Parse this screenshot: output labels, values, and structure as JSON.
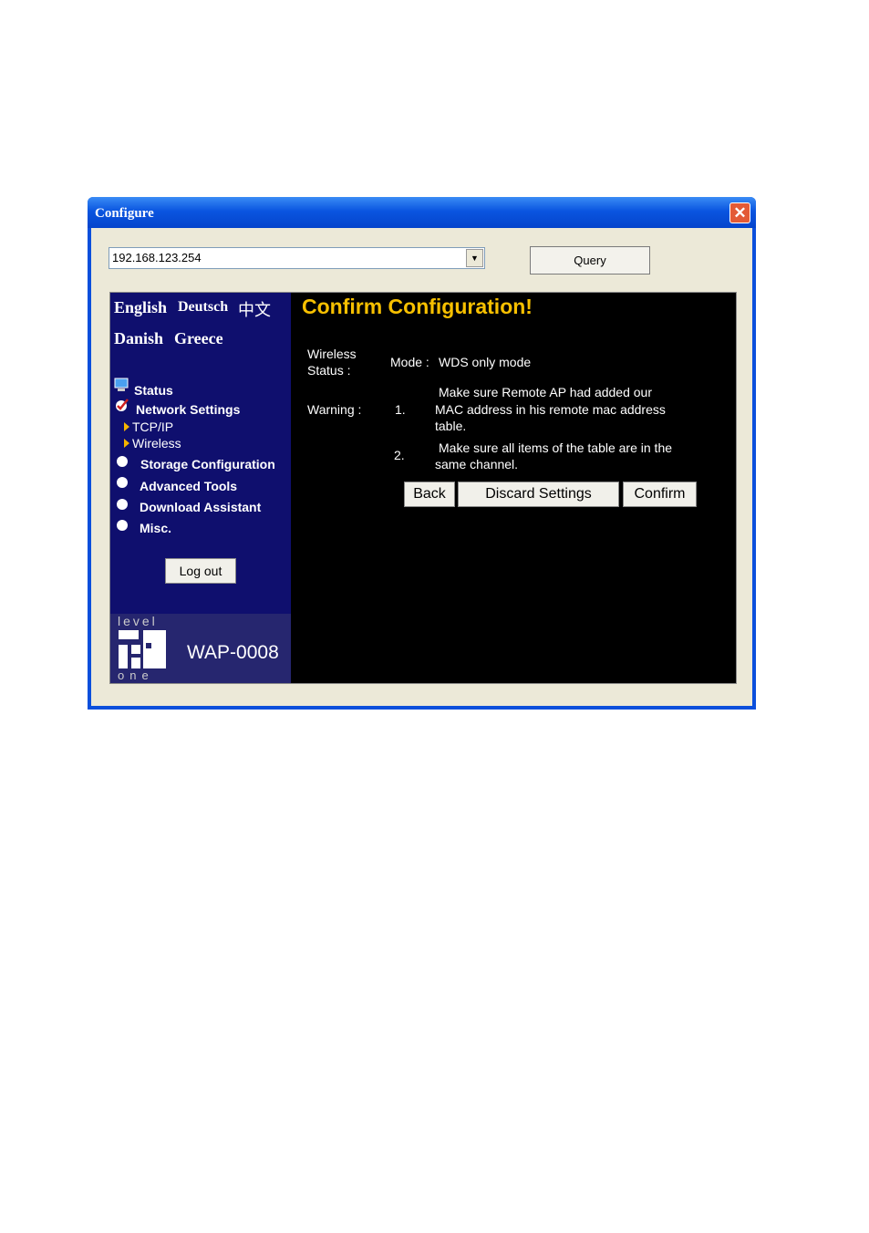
{
  "window": {
    "title": "Configure"
  },
  "address_combo": {
    "value": "192.168.123.254"
  },
  "query_button": "Query",
  "languages": [
    "English",
    "Deutsch",
    "中文",
    "Danish",
    "Greece"
  ],
  "nav": {
    "status": "Status",
    "network_settings": "Network Settings",
    "tcpip": "TCP/IP",
    "wireless": "Wireless",
    "storage": "Storage Configuration",
    "advanced": "Advanced Tools",
    "download": "Download Assistant",
    "misc": "Misc."
  },
  "logout": "Log out",
  "logo": {
    "brand_top": "level",
    "brand_bottom": "one",
    "model": "WAP-0008"
  },
  "main": {
    "heading": "Confirm Configuration!",
    "wireless_status_label1": "Wireless",
    "wireless_status_label2": "Status :",
    "mode_label": "Mode :",
    "mode_value": "WDS only mode",
    "warning_label": "Warning :",
    "item1_num": "1.",
    "item1_line1": "Make sure Remote AP had added our",
    "item1_line2": "MAC address in his remote mac address",
    "item1_line3": "table.",
    "item2_num": "2.",
    "item2_line1": "Make sure all items of the table are in the",
    "item2_line2": "same channel."
  },
  "buttons": {
    "back": "Back",
    "discard": "Discard Settings",
    "confirm": "Confirm"
  },
  "colors": {
    "heading": "#f7c000",
    "sidebar": "#0f0f6e",
    "titlebar": "#0a55e0"
  }
}
